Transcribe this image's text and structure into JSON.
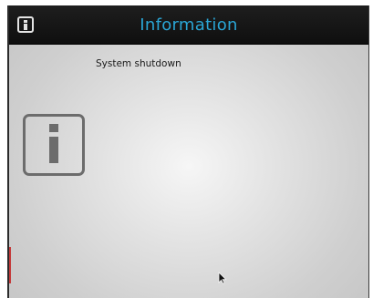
{
  "window": {
    "title": "Information",
    "title_icon": "info-icon",
    "accent_color": "#2aa6d6"
  },
  "dialog": {
    "message": "System shutdown",
    "icon": "info-icon"
  },
  "pointer": {
    "icon": "mouse-cursor-icon"
  }
}
